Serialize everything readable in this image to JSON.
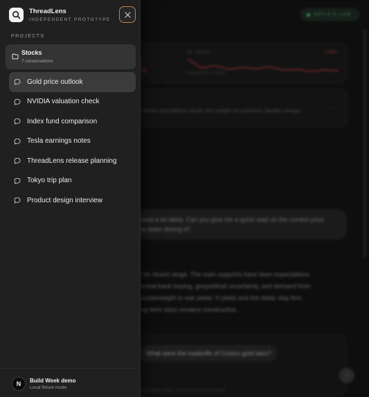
{
  "app": {
    "name": "ThreadLens",
    "tagline": "INDEPENDENT PROTOTYPE"
  },
  "sidebar": {
    "section_label": "PROJECTS",
    "project": {
      "title": "Stocks",
      "count_label": "7 conversations"
    },
    "conversations": [
      {
        "label": "Gold price outlook",
        "active": true
      },
      {
        "label": "NVIDIA valuation check",
        "active": false
      },
      {
        "label": "Index fund comparison",
        "active": false
      },
      {
        "label": "Tesla earnings notes",
        "active": false
      },
      {
        "label": "ThreadLens release planning",
        "active": false
      },
      {
        "label": "Tokyo trip plan",
        "active": false
      },
      {
        "label": "Product design interview",
        "active": false
      }
    ],
    "user": {
      "initial": "N",
      "name": "Build Week demo",
      "mode": "Local fixture mode"
    }
  },
  "background": {
    "model_badge": "GPT-5.5 LIVE",
    "ticker": {
      "name": "XE: Market",
      "change": "-0.66%",
      "left_line1": "0",
      "left_line2": "7%",
      "timestamp": "Updated 10:24 • 1:00 PM"
    },
    "insight_text": "r drivers and pullback signals, then weighs the premiums, liquidity, storage...",
    "user_message": [
      "oved a lot lately. Can you give me a quick read on the current price",
      "as been driving it?"
    ],
    "assistant_message": [
      "f its recent range. The main supports have been expectations",
      "entral-bank buying, geopolitical uncertainty, and demand from",
      "ounterweight is real yields: if yields and the dollar stay firm,",
      "ng-term story remains constructive."
    ],
    "suggestion_chip": "What were the tradeoffs of Costco gold bars?",
    "disclaimer": "conversation context · searches the web when needed"
  },
  "chart_data": {
    "type": "line",
    "series": [
      {
        "values": [
          60,
          46,
          50,
          44,
          47,
          45,
          48,
          43,
          44,
          41,
          43,
          42
        ]
      }
    ]
  },
  "colors": {
    "accent_close_border": "#b08a4a",
    "negative": "#c0414b",
    "live": "#4fd07a"
  },
  "icons": {
    "logo": "search-lens-icon",
    "close": "close-icon",
    "folder": "folder-icon",
    "conversation": "chat-bubble-icon",
    "send": "arrow-up-icon"
  }
}
